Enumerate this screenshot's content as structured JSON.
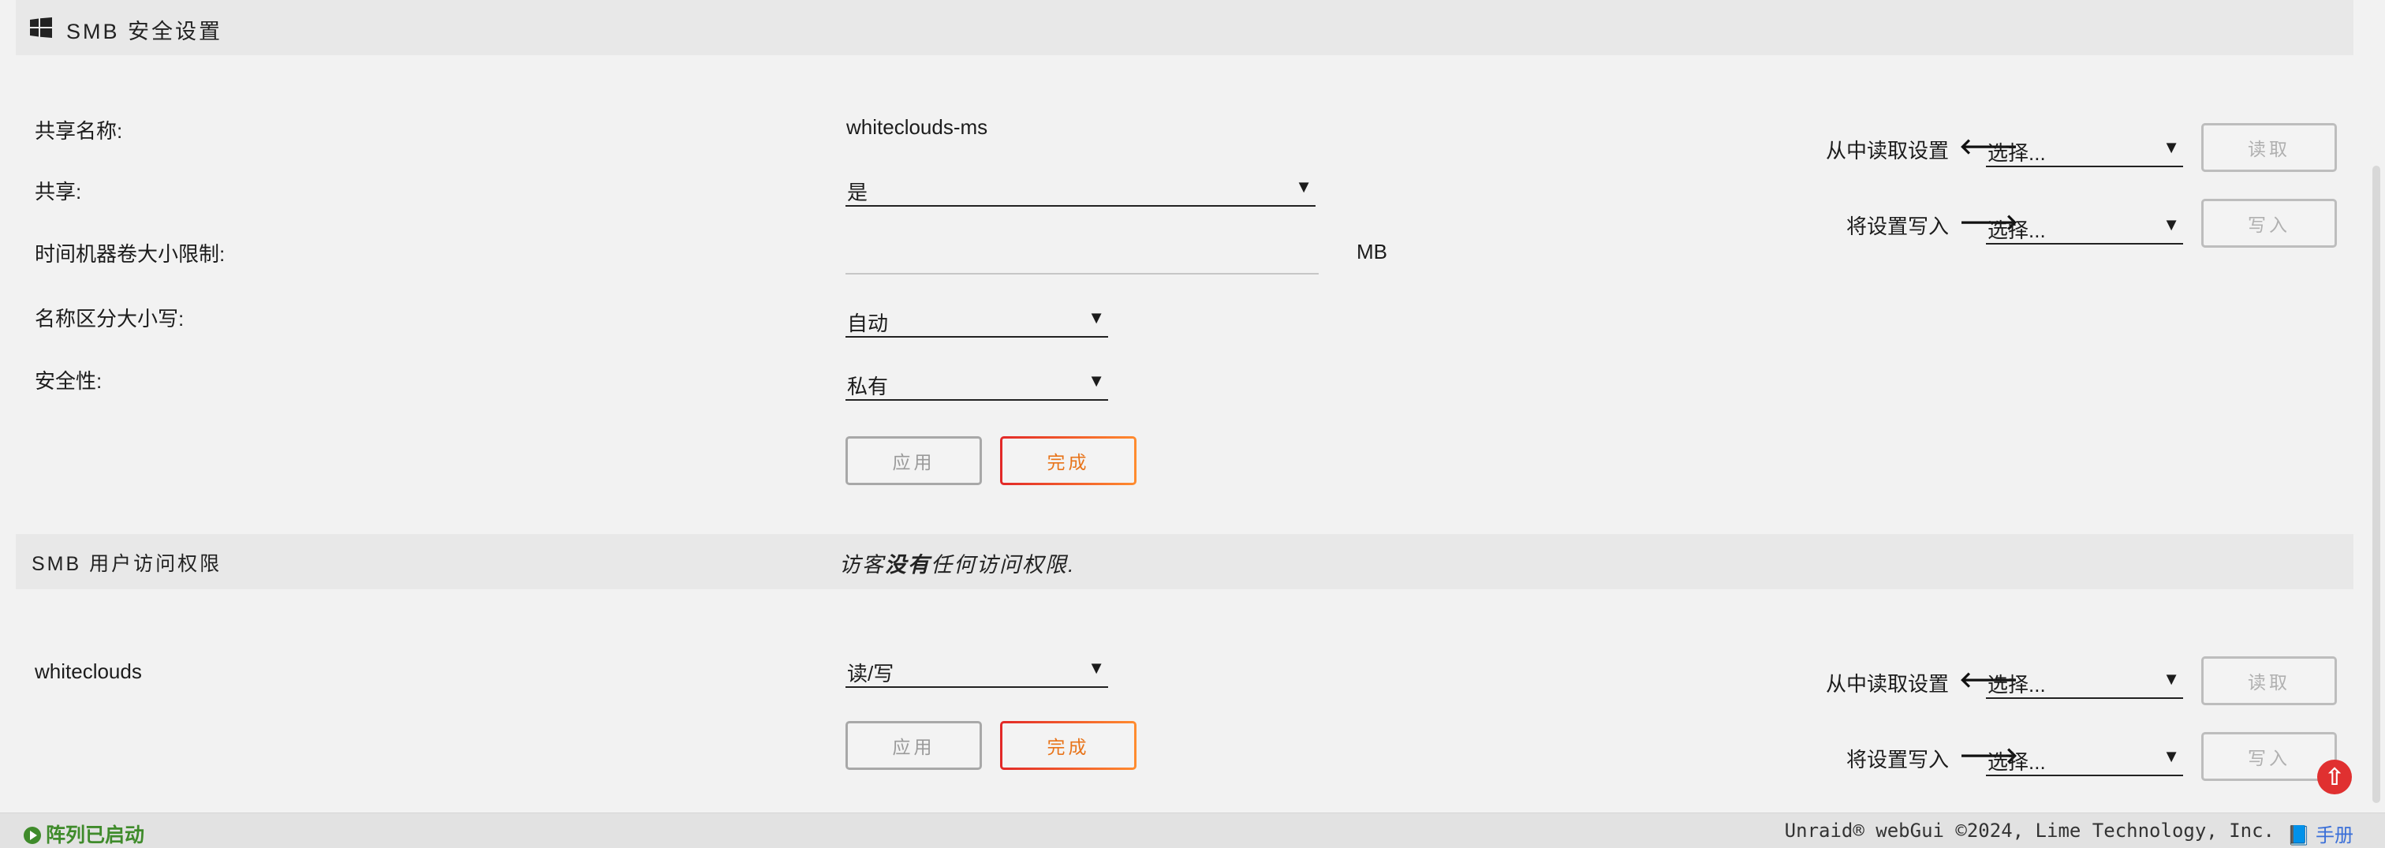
{
  "smb_security": {
    "title": "SMB 安全设置",
    "share_name_label": "共享名称:",
    "share_name_value": "whiteclouds-ms",
    "export_label": "共享:",
    "export_value": "是",
    "tm_limit_label": "时间机器卷大小限制:",
    "tm_limit_value": "",
    "tm_limit_unit": "MB",
    "case_label": "名称区分大小写:",
    "case_value": "自动",
    "security_label": "安全性:",
    "security_value": "私有",
    "apply_label": "应用",
    "done_label": "完成",
    "read_from_label": "从中读取设置",
    "read_from_select": "选择...",
    "read_button": "读取",
    "write_to_label": "将设置写入",
    "write_to_select": "选择...",
    "write_button": "写入"
  },
  "smb_user_access": {
    "title": "SMB 用户访问权限",
    "guest_note_prefix": "访客",
    "guest_note_bold": "没有",
    "guest_note_suffix": "任何访问权限.",
    "user_name": "whiteclouds",
    "user_access_value": "读/写",
    "apply_label": "应用",
    "done_label": "完成",
    "read_from_label": "从中读取设置",
    "read_from_select": "选择...",
    "read_button": "读取",
    "write_to_label": "将设置写入",
    "write_to_select": "选择...",
    "write_button": "写入"
  },
  "footer": {
    "status": "阵列已启动",
    "copyright": "Unraid® webGui ©2024, Lime Technology, Inc.",
    "manual": "手册"
  },
  "colors": {
    "status_green": "#3f8b2b",
    "done_orange": "#e8741a",
    "done_red": "#e22828",
    "top_button_red": "#e03030",
    "manual_blue": "#3a6fd8"
  }
}
